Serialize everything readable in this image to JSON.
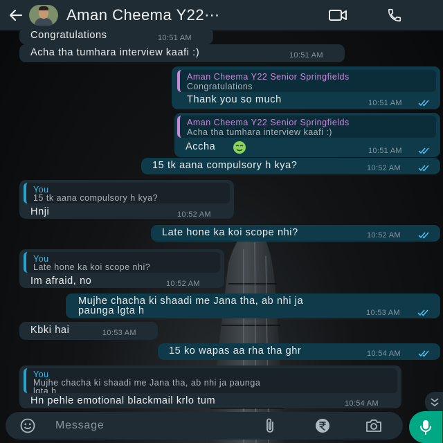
{
  "header": {
    "title": "Aman Cheema Y22⋯",
    "icons": [
      "back-arrow-icon",
      "video-call-icon",
      "phone-icon"
    ]
  },
  "messages": [
    {
      "dir": "in",
      "text": "Congratulations",
      "time": "10:51 AM"
    },
    {
      "dir": "in",
      "text": "Acha tha tumhara interview kaafi :)",
      "time": "10:51 AM"
    },
    {
      "dir": "out",
      "quote_name": "Aman Cheema Y22 Senior Springfields",
      "quote_text": "Congratulations",
      "text": "Thank you so much",
      "time": "10:51 AM"
    },
    {
      "dir": "out",
      "quote_name": "Aman Cheema Y22 Senior Springfields",
      "quote_text": "Acha tha tumhara interview kaafi :)",
      "text": "Accha",
      "time": "10:51 AM"
    },
    {
      "dir": "out",
      "text": "15 tk aana compulsory h kya?",
      "time": "10:52 AM"
    },
    {
      "dir": "in",
      "quote_name": "You",
      "quote_text": "15 tk aana compulsory h kya?",
      "text": "Hnji",
      "time": "10:52 AM"
    },
    {
      "dir": "out",
      "text": "Late hone ka koi scope nhi?",
      "time": "10:52 AM"
    },
    {
      "dir": "in",
      "quote_name": "You",
      "quote_text": "Late hone ka koi scope nhi?",
      "text": "Im afraid, no",
      "time": "10:52 AM"
    },
    {
      "dir": "out",
      "text_line1": "Mujhe chacha ki shaadi me Jana tha, ab nhi ja",
      "text_line2": "paunga lgta h",
      "time": "10:53 AM"
    },
    {
      "dir": "in",
      "text": "Kbki hai",
      "time": "10:53 AM"
    },
    {
      "dir": "out",
      "text": "15 ko wapas aa rha tha ghr",
      "time": "10:54 AM"
    },
    {
      "dir": "in",
      "quote_name": "You",
      "quote_line1": "Mujhe chacha ki shaadi me Jana tha, ab nhi ja paunga",
      "quote_line2": "lgta h",
      "text": "Hn pehle emotional blackmail krlo tum",
      "time": "10:54 AM"
    }
  ],
  "composer": {
    "placeholder": "Message",
    "icons": [
      "emoji-icon",
      "attach-icon",
      "rupee-payment-icon",
      "camera-icon",
      "mic-icon"
    ]
  },
  "colors": {
    "header_bg": "#1f2c33",
    "incoming_bubble": "#1f2c34",
    "outgoing_bubble": "#0e3a4a",
    "read_ticks": "#53bdeb",
    "accent_green": "#00a884",
    "quote_name_contact": "#c88ad6",
    "quote_name_you": "#3fb6e0"
  }
}
